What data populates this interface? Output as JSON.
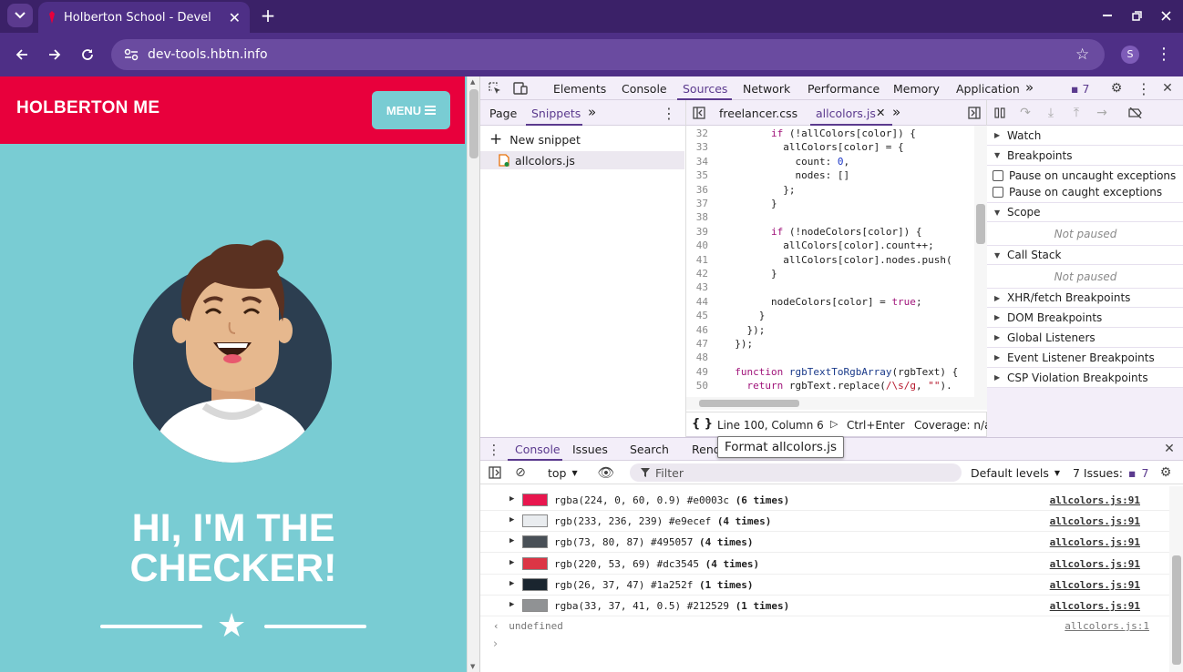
{
  "browser": {
    "tab_title": "Holberton School - Devel",
    "url": "dev-tools.hbtn.info",
    "profile_initial": "S"
  },
  "page": {
    "brand": "HOLBERTON ME",
    "menu_label": "MENU",
    "hero_line1": "HI, I'M THE",
    "hero_line2": "CHECKER!"
  },
  "devtools": {
    "main_tabs": [
      "Elements",
      "Console",
      "Sources",
      "Network",
      "Performance",
      "Memory",
      "Application"
    ],
    "selected_tab": "Sources",
    "issues_count": "7",
    "nav_tabs": [
      "Page",
      "Snippets"
    ],
    "new_snippet_label": "New snippet",
    "snippet_file": "allcolors.js",
    "editor_tabs": [
      "freelancer.css",
      "allcolors.js"
    ],
    "code_lines": [
      {
        "n": "32",
        "segs": [
          [
            "",
            "        "
          ],
          [
            "kw",
            "if"
          ],
          [
            "",
            " (!allColors[color]) {"
          ]
        ]
      },
      {
        "n": "33",
        "segs": [
          [
            "",
            "          allColors[color] = {"
          ]
        ]
      },
      {
        "n": "34",
        "segs": [
          [
            "",
            "            count: "
          ],
          [
            "num",
            "0"
          ],
          [
            "",
            ","
          ]
        ]
      },
      {
        "n": "35",
        "segs": [
          [
            "",
            "            nodes: []"
          ]
        ]
      },
      {
        "n": "36",
        "segs": [
          [
            "",
            "          };"
          ]
        ]
      },
      {
        "n": "37",
        "segs": [
          [
            "",
            "        }"
          ]
        ]
      },
      {
        "n": "38",
        "segs": [
          [
            "",
            ""
          ]
        ]
      },
      {
        "n": "39",
        "segs": [
          [
            "",
            "        "
          ],
          [
            "kw",
            "if"
          ],
          [
            "",
            " (!nodeColors[color]) {"
          ]
        ]
      },
      {
        "n": "40",
        "segs": [
          [
            "",
            "          allColors[color].count++;"
          ]
        ]
      },
      {
        "n": "41",
        "segs": [
          [
            "",
            "          allColors[color].nodes.push("
          ]
        ]
      },
      {
        "n": "42",
        "segs": [
          [
            "",
            "        }"
          ]
        ]
      },
      {
        "n": "43",
        "segs": [
          [
            "",
            ""
          ]
        ]
      },
      {
        "n": "44",
        "segs": [
          [
            "",
            "        nodeColors[color] = "
          ],
          [
            "kw",
            "true"
          ],
          [
            "",
            ";"
          ]
        ]
      },
      {
        "n": "45",
        "segs": [
          [
            "",
            "      }"
          ]
        ]
      },
      {
        "n": "46",
        "segs": [
          [
            "",
            "    });"
          ]
        ]
      },
      {
        "n": "47",
        "segs": [
          [
            "",
            "  });"
          ]
        ]
      },
      {
        "n": "48",
        "segs": [
          [
            "",
            ""
          ]
        ]
      },
      {
        "n": "49",
        "segs": [
          [
            "",
            "  "
          ],
          [
            "kw",
            "function"
          ],
          [
            "",
            " "
          ],
          [
            "fn",
            "rgbTextToRgbArray"
          ],
          [
            "",
            "(rgbText) {"
          ]
        ]
      },
      {
        "n": "50",
        "segs": [
          [
            "",
            "    "
          ],
          [
            "kw",
            "return"
          ],
          [
            "",
            " rgbText.replace("
          ],
          [
            "str",
            "/\\s/g"
          ],
          [
            "",
            ", "
          ],
          [
            "str",
            "\"\""
          ],
          [
            "",
            ")."
          ]
        ]
      }
    ],
    "status_position": "Line 100, Column 6",
    "run_shortcut": "Ctrl+Enter",
    "coverage": "Coverage: n/a",
    "debugger": {
      "watch": "Watch",
      "breakpoints": "Breakpoints",
      "pause_uncaught": "Pause on uncaught exceptions",
      "pause_caught": "Pause on caught exceptions",
      "scope": "Scope",
      "not_paused": "Not paused",
      "call_stack": "Call Stack",
      "more_sections": [
        "XHR/fetch Breakpoints",
        "DOM Breakpoints",
        "Global Listeners",
        "Event Listener Breakpoints",
        "CSP Violation Breakpoints"
      ]
    },
    "drawer": {
      "tabs": [
        "Console",
        "Issues",
        "Search",
        "Rend"
      ],
      "tooltip": "Format allcolors.js",
      "context": "top",
      "filter_placeholder": "Filter",
      "levels": "Default levels",
      "issues_label": "7 Issues:",
      "issues_count": "7",
      "rows": [
        {
          "color": "#e8164e",
          "text": "rgba(224, 0, 60, 0.9) #e0003c ",
          "times": "(6 times)",
          "link": "allcolors.js:91"
        },
        {
          "color": "#e9ecef",
          "text": "rgb(233, 236, 239) #e9ecef ",
          "times": "(4 times)",
          "link": "allcolors.js:91"
        },
        {
          "color": "#495057",
          "text": "rgb(73, 80, 87) #495057 ",
          "times": "(4 times)",
          "link": "allcolors.js:91"
        },
        {
          "color": "#dc3545",
          "text": "rgb(220, 53, 69) #dc3545 ",
          "times": "(4 times)",
          "link": "allcolors.js:91"
        },
        {
          "color": "#1a252f",
          "text": "rgb(26, 37, 47) #1a252f ",
          "times": "(1 times)",
          "link": "allcolors.js:91"
        },
        {
          "color": "#909294",
          "text": "rgba(33, 37, 41, 0.5) #212529 ",
          "times": "(1 times)",
          "link": "allcolors.js:91"
        }
      ],
      "result": "undefined",
      "result_link": "allcolors.js:1"
    }
  },
  "colors": {
    "chrome_dark": "#3b2168",
    "chrome": "#4e2f86",
    "brand_red": "#e8003c",
    "page_teal": "#79ccd3",
    "devtools_accent": "#5b3a8e"
  }
}
